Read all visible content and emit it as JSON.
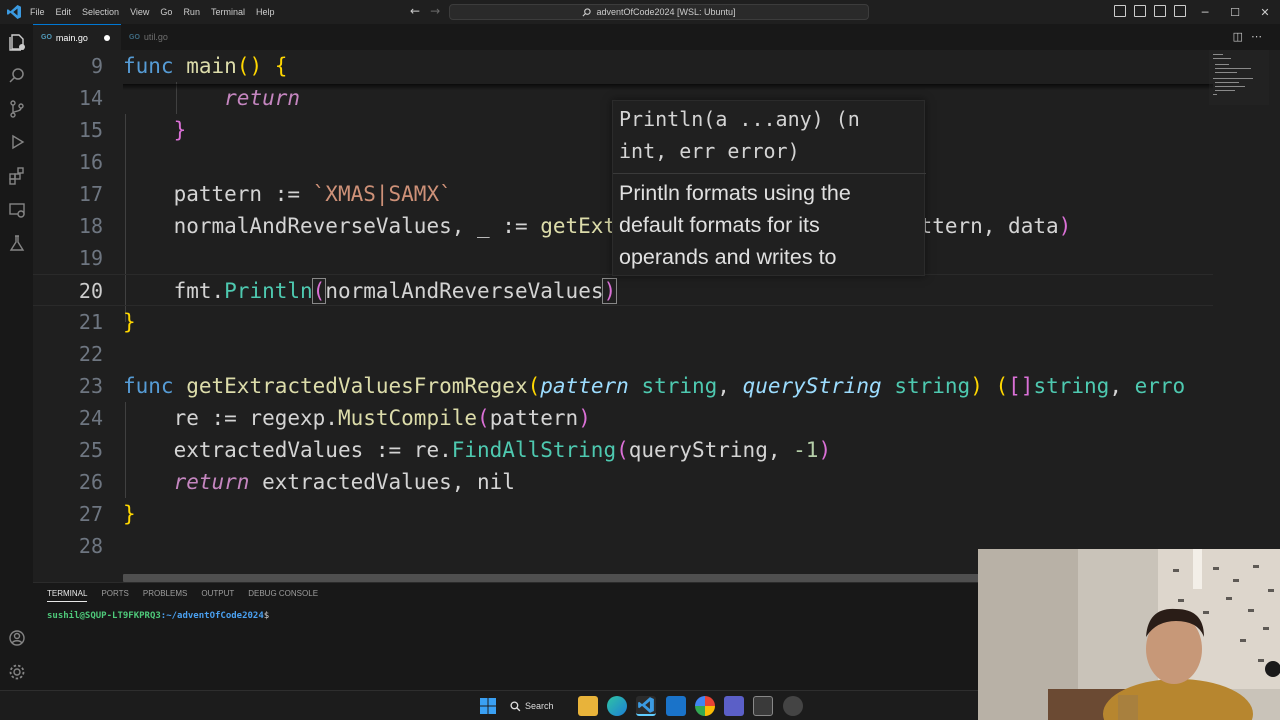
{
  "titlebar": {
    "menu": [
      "File",
      "Edit",
      "Selection",
      "View",
      "Go",
      "Run",
      "Terminal",
      "Help"
    ],
    "command_center": "adventOfCode2024 [WSL: Ubuntu]",
    "controls": {
      "minimize": "─",
      "maximize": "☐",
      "close": "✕"
    }
  },
  "tabs": [
    {
      "label": "main.go",
      "active": true,
      "modified": true
    },
    {
      "label": "util.go",
      "active": false
    }
  ],
  "editor": {
    "lines": [
      {
        "num": "9"
      },
      {
        "num": "14"
      },
      {
        "num": "15"
      },
      {
        "num": "16"
      },
      {
        "num": "17"
      },
      {
        "num": "18"
      },
      {
        "num": "19"
      },
      {
        "num": "20"
      },
      {
        "num": "21"
      },
      {
        "num": "22"
      },
      {
        "num": "23"
      },
      {
        "num": "24"
      },
      {
        "num": "25"
      },
      {
        "num": "26"
      },
      {
        "num": "27"
      },
      {
        "num": "28"
      }
    ],
    "current_line": "20"
  },
  "hover": {
    "signature_line1": "Println(a ...any) (n",
    "signature_line2": "int, err error)",
    "doc_line1": "Println formats using the",
    "doc_line2": "default formats for its",
    "doc_line3": "operands and writes to"
  },
  "panel": {
    "tabs": [
      "TERMINAL",
      "PORTS",
      "PROBLEMS",
      "OUTPUT",
      "DEBUG CONSOLE"
    ],
    "active_tab": "TERMINAL",
    "terminal": {
      "user": "sushil@SQUP-LT9FKPRQ3",
      "path": ":~/adventOfCode2024",
      "prompt": "$"
    }
  },
  "taskbar": {
    "search_label": "Search"
  }
}
